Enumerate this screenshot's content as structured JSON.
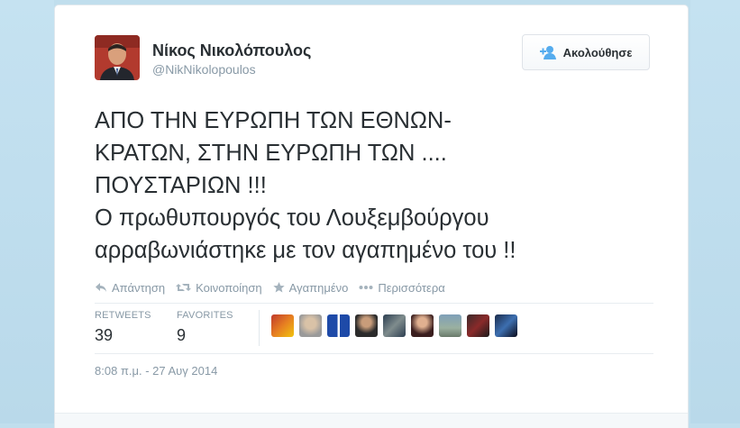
{
  "tweet": {
    "author_name": "Νίκος Νικολόπουλος",
    "author_handle": "@NikNikolopoulos",
    "follow_label": "Ακολούθησε",
    "text_lines": [
      "ΑΠΟ ΤΗΝ ΕΥΡΩΠΗ ΤΩΝ ΕΘΝΩΝ-",
      "ΚΡΑΤΩΝ, ΣΤΗΝ ΕΥΡΩΠΗ ΤΩΝ ....",
      "ΠΟΥΣΤΑΡΙΩΝ !!!",
      "Ο πρωθυπουργός του Λουξεμβούργου",
      "αρραβωνιάστηκε με τον αγαπημένο του !!"
    ],
    "timestamp": "8:08 π.μ. - 27 Αυγ 2014"
  },
  "actions": {
    "reply": {
      "label": "Απάντηση",
      "icon": "reply-icon"
    },
    "retweet": {
      "label": "Κοινοποίηση",
      "icon": "retweet-icon"
    },
    "favorite": {
      "label": "Αγαπημένο",
      "icon": "star-icon"
    },
    "more": {
      "label": "Περισσότερα",
      "icon": "ellipsis-icon"
    }
  },
  "stats": {
    "retweets_label": "RETWEETS",
    "retweets_value": "39",
    "favorites_label": "FAVORITES",
    "favorites_value": "9"
  },
  "colors": {
    "page_background": "#c0deed",
    "text": "#292f33",
    "muted": "#8899a6",
    "follow_icon": "#55acee"
  }
}
